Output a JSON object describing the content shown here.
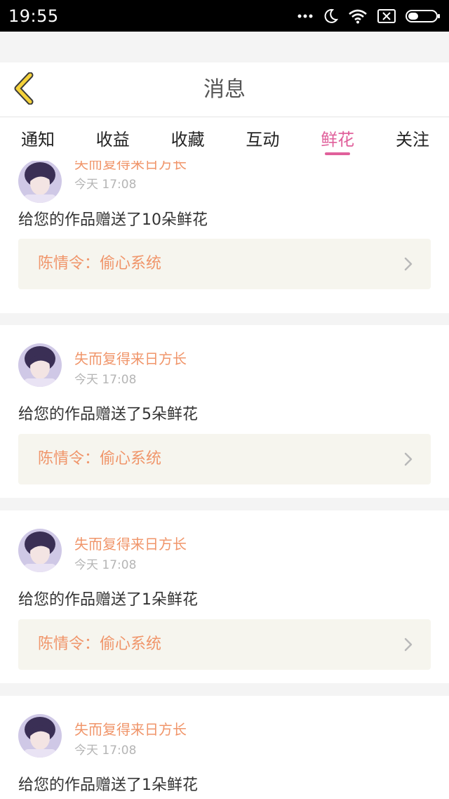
{
  "status_bar": {
    "time": "19:55",
    "icons": [
      "more-dots-icon",
      "moon-icon",
      "wifi-icon",
      "sim-off-icon",
      "battery-icon"
    ]
  },
  "header": {
    "back_icon": "chevron-left-icon",
    "title": "消息"
  },
  "tabs": [
    {
      "label": "通知",
      "active": false
    },
    {
      "label": "收益",
      "active": false
    },
    {
      "label": "收藏",
      "active": false
    },
    {
      "label": "互动",
      "active": false
    },
    {
      "label": "鲜花",
      "active": true
    },
    {
      "label": "关注",
      "active": false
    }
  ],
  "colors": {
    "accent_pink": "#e0609b",
    "username_orange": "#f0956a",
    "card_link_bg": "#f6f5ee",
    "back_yellow": "#f5d23a"
  },
  "messages": [
    {
      "username": "失而复得来日方长",
      "time": "今天 17:08",
      "text": "给您的作品赠送了10朵鲜花",
      "work_title": "陈情令：偷心系统"
    },
    {
      "username": "失而复得来日方长",
      "time": "今天 17:08",
      "text": "给您的作品赠送了5朵鲜花",
      "work_title": "陈情令：偷心系统"
    },
    {
      "username": "失而复得来日方长",
      "time": "今天 17:08",
      "text": "给您的作品赠送了1朵鲜花",
      "work_title": "陈情令：偷心系统"
    },
    {
      "username": "失而复得来日方长",
      "time": "今天 17:08",
      "text": "给您的作品赠送了1朵鲜花",
      "work_title": ""
    }
  ]
}
